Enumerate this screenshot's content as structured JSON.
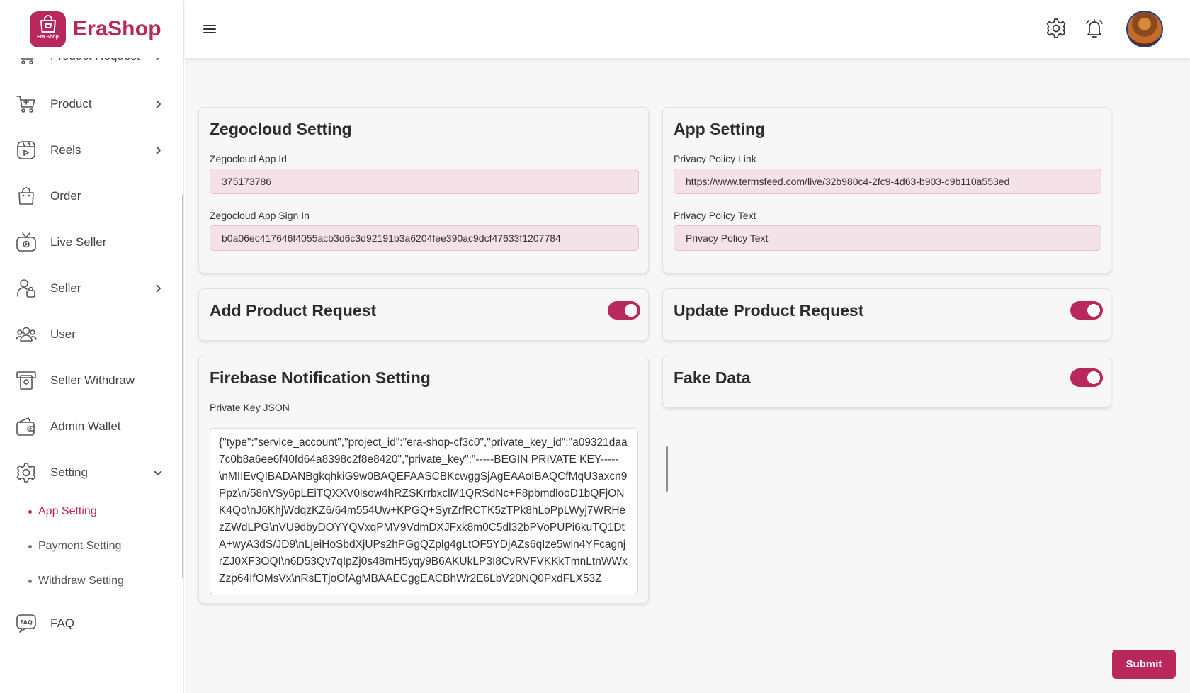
{
  "brand": {
    "name": "EraShop",
    "logo_text": "Era Shop",
    "color": "#b8285a"
  },
  "sidebar": {
    "items": [
      {
        "label": "Product Request",
        "icon": "cart-icon",
        "has_chevron": true
      },
      {
        "label": "Product",
        "icon": "cart-icon",
        "has_chevron": true
      },
      {
        "label": "Reels",
        "icon": "reels-icon",
        "has_chevron": true
      },
      {
        "label": "Order",
        "icon": "bag-icon",
        "has_chevron": false
      },
      {
        "label": "Live Seller",
        "icon": "tv-icon",
        "has_chevron": false
      },
      {
        "label": "Seller",
        "icon": "seller-icon",
        "has_chevron": true
      },
      {
        "label": "User",
        "icon": "users-icon",
        "has_chevron": false
      },
      {
        "label": "Seller Withdraw",
        "icon": "atm-icon",
        "has_chevron": false
      },
      {
        "label": "Admin Wallet",
        "icon": "wallet-icon",
        "has_chevron": false
      },
      {
        "label": "Setting",
        "icon": "gear-icon",
        "has_chevron": true,
        "expanded": true
      },
      {
        "label": "FAQ",
        "icon": "faq-icon",
        "has_chevron": false
      }
    ],
    "setting_sub": [
      {
        "label": "App Setting",
        "active": true
      },
      {
        "label": "Payment Setting",
        "active": false
      },
      {
        "label": "Withdraw Setting",
        "active": false
      }
    ]
  },
  "header": {
    "icons": [
      "menu-icon",
      "gear-icon",
      "bell-icon",
      "avatar"
    ]
  },
  "zegocloud": {
    "title": "Zegocloud Setting",
    "app_id_label": "Zegocloud App Id",
    "app_id_value": "375173786",
    "sign_in_label": "Zegocloud App Sign In",
    "sign_in_value": "b0a06ec417646f4055acb3d6c3d92191b3a6204fee390ac9dcf47633f1207784"
  },
  "app_setting": {
    "title": "App Setting",
    "privacy_link_label": "Privacy Policy Link",
    "privacy_link_value": "https://www.termsfeed.com/live/32b980c4-2fc9-4d63-b903-c9b110a553ed",
    "privacy_text_label": "Privacy Policy Text",
    "privacy_text_value": "Privacy Policy Text"
  },
  "toggles": {
    "add_product_request": {
      "label": "Add Product Request",
      "on": true
    },
    "update_product_request": {
      "label": "Update Product Request",
      "on": true
    },
    "fake_data": {
      "label": "Fake Data",
      "on": true
    }
  },
  "firebase": {
    "title": "Firebase Notification Setting",
    "key_label": "Private Key JSON",
    "key_value": "{\"type\":\"service_account\",\"project_id\":\"era-shop-cf3c0\",\"private_key_id\":\"a09321daa7c0b8a6ee6f40fd64a8398c2f8e8420\",\"private_key\":\"-----BEGIN PRIVATE KEY-----\\nMIIEvQIBADANBgkqhkiG9w0BAQEFAASCBKcwggSjAgEAAoIBAQCfMqU3axcn9Ppz\\n/58nVSy6pLEiTQXXV0isow4hRZSKrrbxclM1QRSdNc+F8pbmdlooD1bQFjONK4Qo\\nJ6KhjWdqzKZ6/64m554Uw+KPGQ+SyrZrfRCTK5zTPk8hLoPpLWyj7WRHezZWdLPG\\nVU9dbyDOYYQVxqPMV9VdmDXJFxk8m0C5dl32bPVoPUPi6kuTQ1DtA+wyA3dS/JD9\\nLjeiHoSbdXjUPs2hPGgQZplg4gLtOF5YDjAZs6qIze5win4YFcagnjrZJ0XF3OQI\\n6D53Qv7qIpZj0s48mH5yqy9B6AKUkLP3I8CvRVFVKKkTmnLtnWWxZzp64IfOMsVx\\nRsETjoOfAgMBAAECggEACBhWr2E6LbV20NQ0PxdFLX53Z"
  },
  "submit_label": "Submit"
}
